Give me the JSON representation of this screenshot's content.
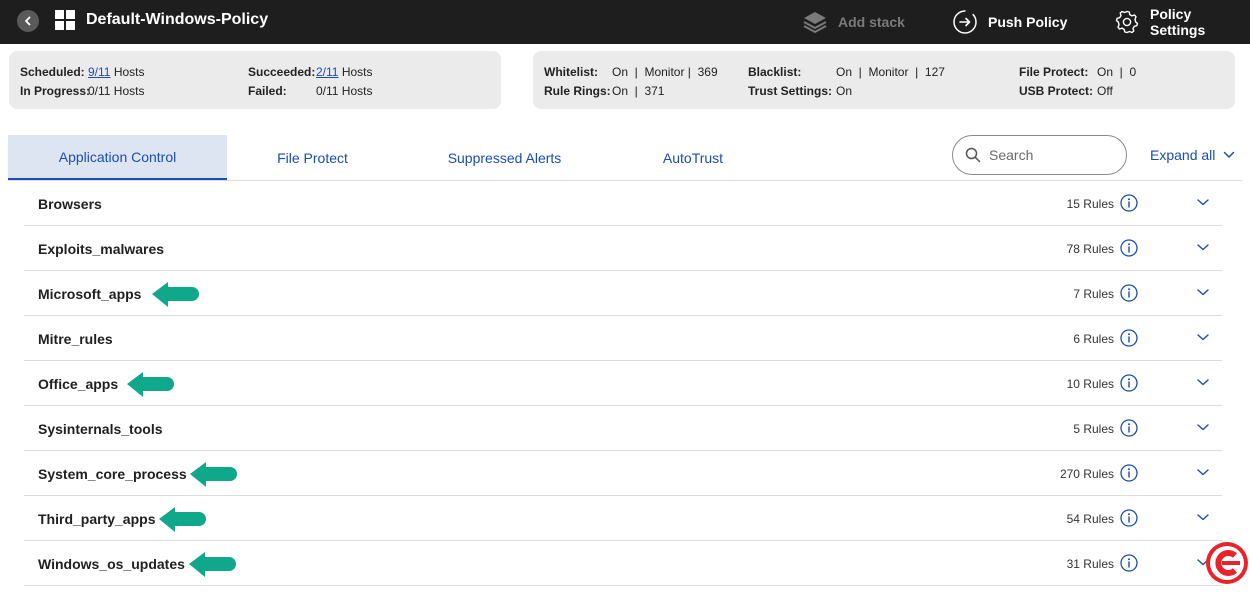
{
  "header": {
    "title": "Default-Windows-Policy",
    "add_stack": "Add stack",
    "push_policy": "Push Policy",
    "policy_settings": "Policy Settings"
  },
  "summary_left": {
    "scheduled_label": "Scheduled:",
    "scheduled_value": "9/11",
    "scheduled_suffix": "Hosts",
    "in_progress_label": "In Progress:",
    "in_progress_value": "0/11 Hosts",
    "succeeded_label": "Succeeded:",
    "succeeded_value": "2/11",
    "succeeded_suffix": "Hosts",
    "failed_label": "Failed:",
    "failed_value": "0/11 Hosts"
  },
  "summary_right": {
    "whitelist_label": "Whitelist:",
    "whitelist_value": "On  |  Monitor |  369",
    "rule_rings_label": "Rule Rings:",
    "rule_rings_value": "On  |  371",
    "blacklist_label": "Blacklist:",
    "blacklist_value": "On  |  Monitor  |  127",
    "trust_settings_label": "Trust Settings:",
    "trust_settings_value": "On",
    "file_protect_label": "File Protect:",
    "file_protect_value": "On  |  0",
    "usb_protect_label": "USB Protect:",
    "usb_protect_value": "Off"
  },
  "tabs": [
    {
      "label": "Application Control",
      "active": true
    },
    {
      "label": "File Protect",
      "active": false
    },
    {
      "label": "Suppressed Alerts",
      "active": false
    },
    {
      "label": "AutoTrust",
      "active": false
    }
  ],
  "search": {
    "placeholder": "Search"
  },
  "expand_all": "Expand all",
  "rules": [
    {
      "name": "Browsers",
      "count": "15 Rules",
      "highlighted": false
    },
    {
      "name": "Exploits_malwares",
      "count": "78 Rules",
      "highlighted": false
    },
    {
      "name": "Microsoft_apps",
      "count": "7 Rules",
      "highlighted": true
    },
    {
      "name": "Mitre_rules",
      "count": "6 Rules",
      "highlighted": false
    },
    {
      "name": "Office_apps",
      "count": "10 Rules",
      "highlighted": true
    },
    {
      "name": "Sysinternals_tools",
      "count": "5 Rules",
      "highlighted": false
    },
    {
      "name": "System_core_process",
      "count": "270 Rules",
      "highlighted": true
    },
    {
      "name": "Third_party_apps",
      "count": "54 Rules",
      "highlighted": true
    },
    {
      "name": "Windows_os_updates",
      "count": "31 Rules",
      "highlighted": true
    }
  ],
  "colors": {
    "accent": "#1a4db3",
    "arrow": "#0fa88a",
    "brand": "#e8242a"
  }
}
